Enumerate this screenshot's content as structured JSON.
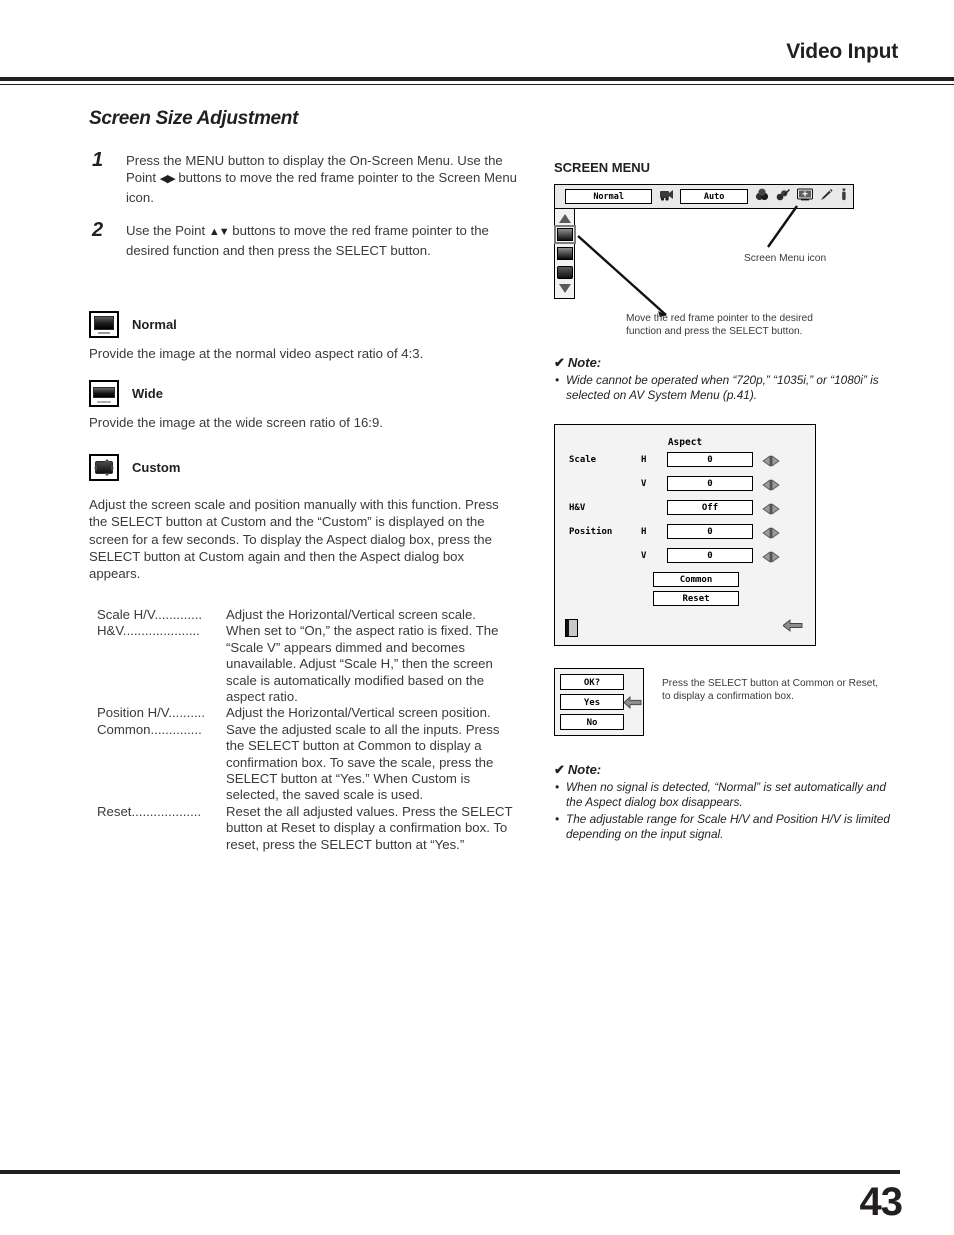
{
  "header": {
    "title": "Video Input"
  },
  "footer": {
    "page_number": "43"
  },
  "left": {
    "section_title": "Screen Size Adjustment",
    "steps": [
      {
        "number": "1",
        "text_before": "Press the MENU button to display the On-Screen Menu. Use the Point ",
        "glyph": "◀▶",
        "text_after": " buttons to move the red frame pointer to the Screen Menu icon."
      },
      {
        "number": "2",
        "text_before": "Use the Point ",
        "glyph": "▲▼",
        "text_after": " buttons to move the red frame pointer to the desired function and then press the SELECT button."
      }
    ],
    "modes": [
      {
        "icon": "normal-aspect-icon",
        "label": "Normal",
        "description": "Provide the image at the normal video aspect ratio of 4:3."
      },
      {
        "icon": "wide-aspect-icon",
        "label": "Wide",
        "description": "Provide the image at the wide screen ratio of 16:9."
      },
      {
        "icon": "custom-aspect-icon",
        "label": "Custom",
        "description": ""
      }
    ],
    "custom_paragraph": "Adjust the screen scale and position manually with this function. Press the SELECT button at Custom and the “Custom” is displayed on the screen for a few seconds. To display the Aspect dialog box, press the SELECT button at Custom again and then the Aspect dialog box appears.",
    "definitions": [
      {
        "term": "Scale H/V",
        "dots": ".............",
        "desc": "Adjust the Horizontal/Vertical screen scale."
      },
      {
        "term": "H&V",
        "dots": ".....................",
        "desc": "When set to “On,” the aspect ratio is fixed. The “Scale V” appears dimmed and becomes unavailable. Adjust “Scale H,” then the screen scale is automatically modified based on the aspect ratio."
      },
      {
        "term": "Position H/V",
        "dots": "..........",
        "desc": "Adjust the Horizontal/Vertical screen position."
      },
      {
        "term": "Common",
        "dots": "..............",
        "desc": "Save the adjusted scale to all the inputs. Press the SELECT button at Common to display a confirmation box. To save the scale, press the SELECT button at “Yes.” When Custom is selected, the saved scale is used."
      },
      {
        "term": "Reset",
        "dots": "...................",
        "desc": "Reset the all adjusted values. Press the SELECT button at Reset to display a confirmation box. To reset, press the SELECT button at “Yes.”"
      }
    ]
  },
  "right": {
    "screen_menu_heading": "SCREEN MENU",
    "osd_bar": {
      "normal_field": "Normal",
      "auto_field": "Auto",
      "icons": [
        "video-camera-icon",
        "color-adjust-icon",
        "image-adjust-icon",
        "screen-menu-icon",
        "pointer-icon",
        "information-icon"
      ]
    },
    "osd_sidebar": {
      "items": [
        "scroll-up-arrow",
        "normal-aspect-icon",
        "wide-aspect-icon",
        "custom-aspect-icon",
        "scroll-down-arrow"
      ]
    },
    "callout_screen_menu_icon": "Screen Menu icon",
    "callout_move_pointer": "Move the red frame pointer to the desired function and press the SELECT button.",
    "note_1": {
      "heading": "Note:",
      "check": "✔",
      "items": [
        "Wide cannot be operated when “720p,” “1035i,” or “1080i” is selected on AV System Menu (p.41)."
      ]
    },
    "aspect_dialog": {
      "title": "Aspect",
      "rows": [
        {
          "label": "Scale",
          "axis": "H",
          "value": "0"
        },
        {
          "label": "",
          "axis": "V",
          "value": "0"
        },
        {
          "label": "H&V",
          "axis": "",
          "value": "Off"
        },
        {
          "label": "Position",
          "axis": "H",
          "value": "0"
        },
        {
          "label": "",
          "axis": "V",
          "value": "0"
        }
      ],
      "buttons": [
        "Common",
        "Reset"
      ],
      "exit_icon": "exit-door-icon",
      "back_icon": "back-arrow-icon"
    },
    "confirm_box": {
      "title": "OK?",
      "yes": "Yes",
      "no": "No",
      "pointer_icon": "left-arrow-pointer-icon",
      "caption": "Press the SELECT button at Common or Reset, to display a confirmation box."
    },
    "note_2": {
      "heading": "Note:",
      "check": "✔",
      "items": [
        "When no signal is detected, “Normal” is set automatically and the Aspect dialog box disappears.",
        "The adjustable range for Scale H/V and Position H/V is limited depending on the input signal."
      ]
    }
  }
}
